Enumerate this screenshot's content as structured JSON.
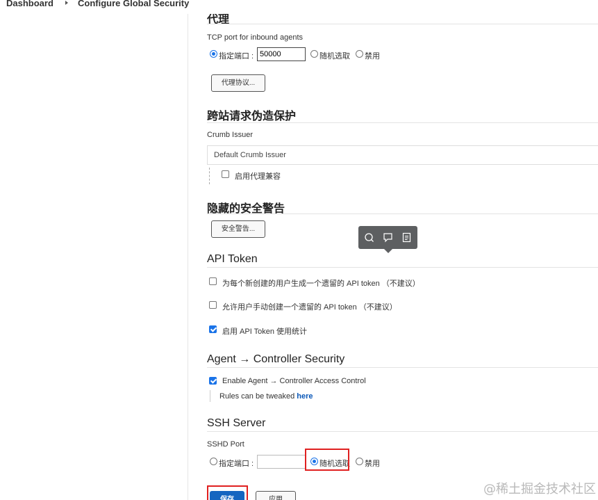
{
  "breadcrumb": {
    "items": [
      "Dashboard",
      "Configure Global Security"
    ]
  },
  "agents": {
    "title": "代理",
    "tcp_label": "TCP port for inbound agents",
    "option_fixed": "指定端口 :",
    "port_value": "50000",
    "option_random": "随机选取",
    "option_disable": "禁用",
    "protocols_button": "代理协议..."
  },
  "csrf": {
    "title": "跨站请求伪造保护",
    "crumb_label": "Crumb Issuer",
    "crumb_value": "Default Crumb Issuer",
    "proxy_compat": "启用代理兼容"
  },
  "hidden_warnings": {
    "title": "隐藏的安全警告",
    "button": "安全警告..."
  },
  "api_token": {
    "title": "API Token",
    "opt1": "为每个新创建的用户生成一个遗留的 API token （不建议）",
    "opt2": "允许用户手动创建一个遗留的 API token （不建议）",
    "opt3": "启用 API Token 使用统计"
  },
  "agent_controller": {
    "title": "Agent → Controller Security",
    "enable": "Enable Agent → Controller Access Control",
    "rules_prefix": "Rules can be tweaked ",
    "rules_link": "here"
  },
  "ssh": {
    "title": "SSH Server",
    "port_label": "SSHD Port",
    "option_fixed": "指定端口 :",
    "port_value": "",
    "option_random": "随机选取",
    "option_disable": "禁用"
  },
  "buttons": {
    "save": "保存",
    "apply": "应用"
  },
  "watermark": "@稀土掘金技术社区",
  "colors": {
    "accent": "#1a73e8",
    "primary_button": "#1565c0",
    "highlight": "#e02020",
    "link": "#0b58b8"
  },
  "icons": {
    "tooltip": [
      "search-icon",
      "comment-icon",
      "note-icon"
    ]
  }
}
